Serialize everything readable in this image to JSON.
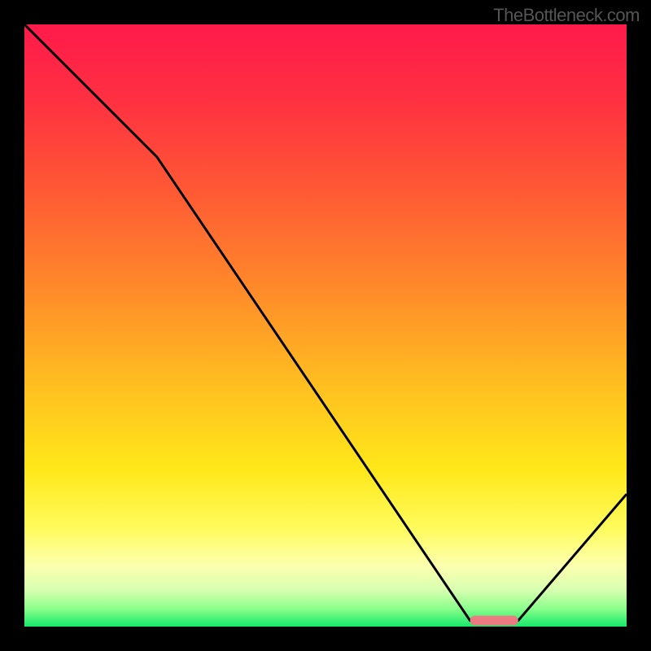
{
  "watermark": "TheBottleneck.com",
  "chart_data": {
    "type": "line",
    "title": "",
    "xlabel": "",
    "ylabel": "",
    "xlim": [
      0,
      100
    ],
    "ylim": [
      0,
      100
    ],
    "x": [
      0,
      22,
      74,
      82,
      100
    ],
    "values": [
      100,
      78,
      1,
      1,
      22
    ],
    "marker": {
      "x_start": 74,
      "x_end": 82,
      "y": 1,
      "color": "#eb7b81"
    },
    "gradient_stops": [
      {
        "pct": 0,
        "color": "#ff1a4b"
      },
      {
        "pct": 12,
        "color": "#ff2f42"
      },
      {
        "pct": 28,
        "color": "#ff5a34"
      },
      {
        "pct": 44,
        "color": "#ff8a2a"
      },
      {
        "pct": 60,
        "color": "#ffbf20"
      },
      {
        "pct": 74,
        "color": "#ffe81a"
      },
      {
        "pct": 84,
        "color": "#fffc60"
      },
      {
        "pct": 90,
        "color": "#fcffb0"
      },
      {
        "pct": 94,
        "color": "#d7ffb0"
      },
      {
        "pct": 97,
        "color": "#8cff8c"
      },
      {
        "pct": 100,
        "color": "#17e86b"
      }
    ]
  }
}
